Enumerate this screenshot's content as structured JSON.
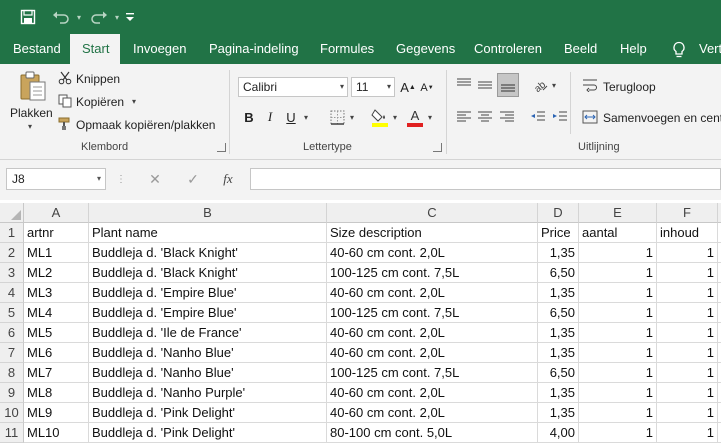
{
  "colors": {
    "brand": "#217346",
    "ribbon_bg": "#f3f3f3",
    "font_color_swatch": "#e02020",
    "fill_color_swatch": "#ffff00"
  },
  "quick_access": {
    "icons": [
      "save-icon",
      "undo-icon",
      "redo-icon",
      "customize-icon"
    ]
  },
  "tabs": [
    "Bestand",
    "Start",
    "Invoegen",
    "Pagina-indeling",
    "Formules",
    "Gegevens",
    "Controleren",
    "Beeld",
    "Help",
    "Vert"
  ],
  "active_tab": "Start",
  "ribbon": {
    "clipboard": {
      "paste_label": "Plakken",
      "cut_label": "Knippen",
      "copy_label": "Kopiëren",
      "format_painter_label": "Opmaak kopiëren/plakken",
      "group_label": "Klembord"
    },
    "font": {
      "font_name": "Calibri",
      "font_size": "11",
      "bold": "B",
      "italic": "I",
      "underline": "U",
      "group_label": "Lettertype"
    },
    "alignment": {
      "wrap_label": "Terugloop",
      "merge_label": "Samenvoegen en cent",
      "group_label": "Uitlijning"
    }
  },
  "formula_bar": {
    "name_box": "J8",
    "cancel": "✕",
    "enter": "✓",
    "fx": "fx",
    "formula": ""
  },
  "sheet": {
    "columns": [
      "A",
      "B",
      "C",
      "D",
      "E",
      "F"
    ],
    "rows": [
      {
        "n": "1",
        "cells": [
          "artnr",
          "Plant name",
          "Size description",
          "Price",
          "aantal",
          "inhoud"
        ]
      },
      {
        "n": "2",
        "cells": [
          "ML1",
          "Buddleja d. 'Black Knight'",
          "40-60 cm cont. 2,0L",
          "1,35",
          "1",
          "1"
        ]
      },
      {
        "n": "3",
        "cells": [
          "ML2",
          "Buddleja d. 'Black Knight'",
          "100-125 cm cont. 7,5L",
          "6,50",
          "1",
          "1"
        ]
      },
      {
        "n": "4",
        "cells": [
          "ML3",
          "Buddleja d. 'Empire Blue'",
          "40-60 cm cont. 2,0L",
          "1,35",
          "1",
          "1"
        ]
      },
      {
        "n": "5",
        "cells": [
          "ML4",
          "Buddleja d. 'Empire Blue'",
          "100-125 cm cont. 7,5L",
          "6,50",
          "1",
          "1"
        ]
      },
      {
        "n": "6",
        "cells": [
          "ML5",
          "Buddleja d. 'Ile de France'",
          "40-60 cm cont. 2,0L",
          "1,35",
          "1",
          "1"
        ]
      },
      {
        "n": "7",
        "cells": [
          "ML6",
          "Buddleja d. 'Nanho Blue'",
          "40-60 cm cont. 2,0L",
          "1,35",
          "1",
          "1"
        ]
      },
      {
        "n": "8",
        "cells": [
          "ML7",
          "Buddleja d. 'Nanho Blue'",
          "100-125 cm cont. 7,5L",
          "6,50",
          "1",
          "1"
        ]
      },
      {
        "n": "9",
        "cells": [
          "ML8",
          "Buddleja d. 'Nanho Purple'",
          "40-60 cm cont. 2,0L",
          "1,35",
          "1",
          "1"
        ]
      },
      {
        "n": "10",
        "cells": [
          "ML9",
          "Buddleja d. 'Pink Delight'",
          "40-60 cm cont. 2,0L",
          "1,35",
          "1",
          "1"
        ]
      },
      {
        "n": "11",
        "cells": [
          "ML10",
          "Buddleja d. 'Pink Delight'",
          "80-100 cm cont. 5,0L",
          "4,00",
          "1",
          "1"
        ]
      }
    ]
  }
}
